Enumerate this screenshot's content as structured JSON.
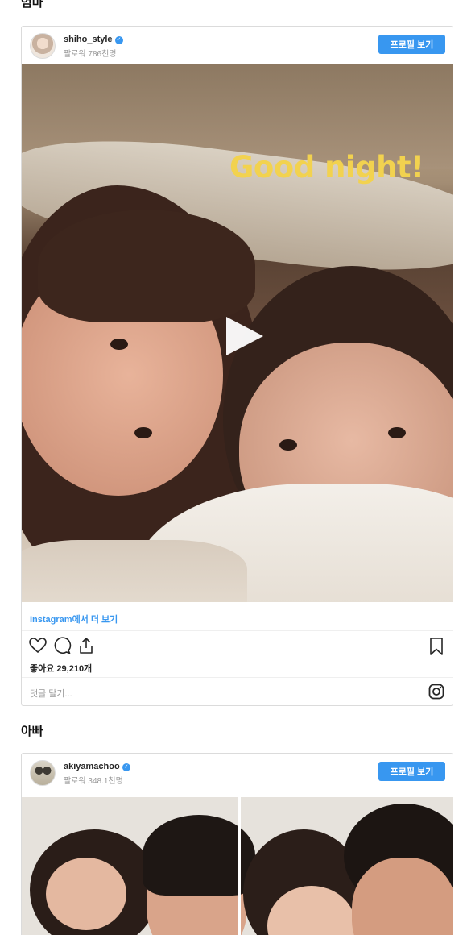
{
  "sections": {
    "mom_heading": "엄마",
    "dad_heading": "아빠"
  },
  "posts": [
    {
      "username": "shiho_style",
      "followers": "팔로워 786천명",
      "profile_button": "프로필 보기",
      "overlay_text": "Good night!",
      "view_more": "Instagram에서 더 보기",
      "likes": "좋아요 29,210개",
      "comment_placeholder": "댓글 달기..."
    },
    {
      "username": "akiyamachoo",
      "followers": "팔로워 348.1천명",
      "profile_button": "프로필 보기"
    }
  ],
  "icons": {
    "verified": "verified-badge-icon",
    "play": "play-icon",
    "like": "heart-icon",
    "comment": "comment-icon",
    "share": "share-icon",
    "save": "bookmark-icon",
    "instagram": "instagram-icon"
  },
  "colors": {
    "accent": "#3897f0",
    "overlay_text": "#f2d24f",
    "muted": "#999999"
  }
}
